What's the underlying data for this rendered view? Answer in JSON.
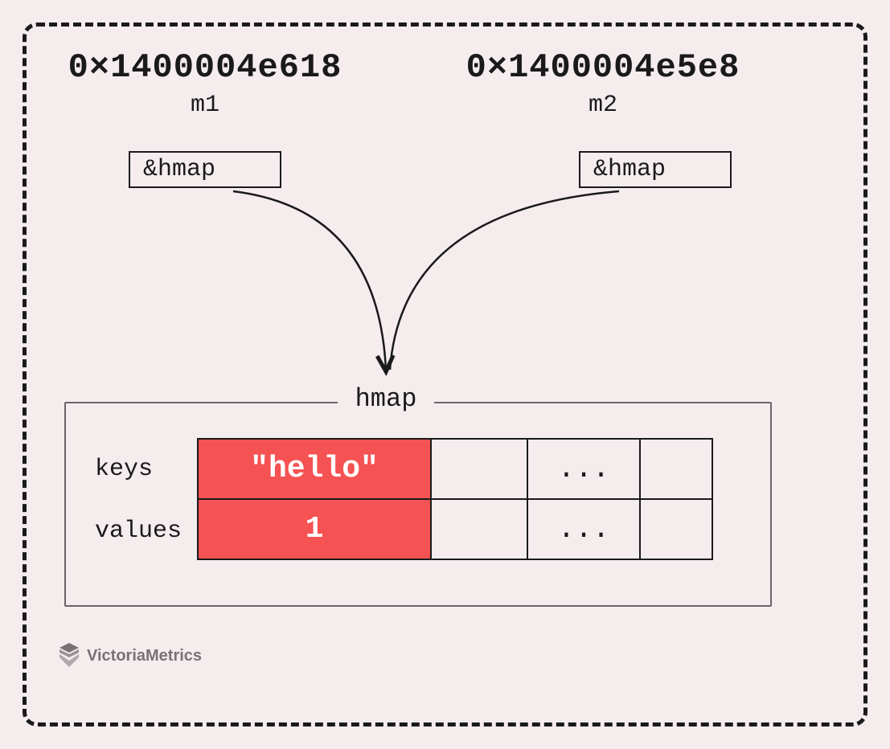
{
  "pointers": {
    "left": {
      "address": "0×1400004e618",
      "var": "m1",
      "box": "&hmap"
    },
    "right": {
      "address": "0×1400004e5e8",
      "var": "m2",
      "box": "&hmap"
    }
  },
  "hmap": {
    "title": "hmap",
    "rows": {
      "keys_label": "keys",
      "values_label": "values"
    },
    "table": {
      "key_cell": "\"hello\"",
      "key_ellipsis": "...",
      "value_cell": "1",
      "value_ellipsis": "..."
    }
  },
  "branding": "VictoriaMetrics"
}
